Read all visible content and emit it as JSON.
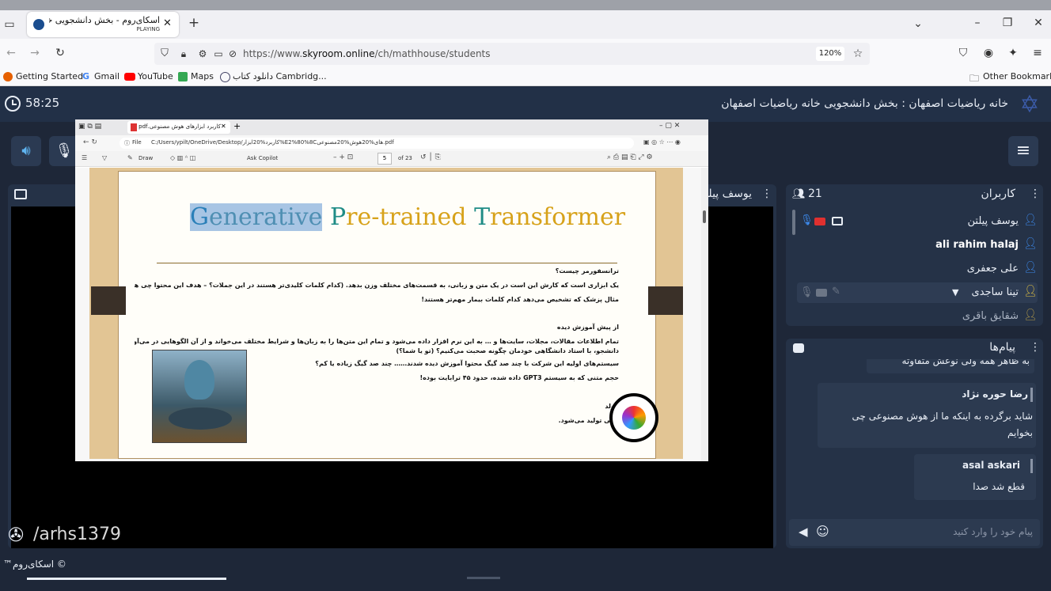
{
  "browser": {
    "tab_title": "اسکای‌روم - بخش دانشجویی خا",
    "tab_status": "PLAYING",
    "url": "https://www.skyroom.online/ch/mathhouse/students",
    "url_prefix": "https://www.",
    "url_domain": "skyroom.online",
    "url_path": "/ch/mathhouse/students",
    "zoom": "120%",
    "bookmarks": [
      "Getting Started",
      "Gmail",
      "YouTube",
      "Maps",
      "دانلود کتاب Cambridg..."
    ],
    "other_bookmarks": "Other Bookmarks"
  },
  "app": {
    "timer": "58:25",
    "room_title": "خانه ریاضیات اصفهان : بخش دانشجویی خانه ریاضیات اصفهان",
    "presenter_name": "یوسف پیلتن",
    "footer_brand": "© اسکای‌روم™",
    "watermark": "/arhs1379"
  },
  "users_panel": {
    "title": "کاربران",
    "count": "21",
    "users": [
      {
        "name": "یوسف پیلتن"
      },
      {
        "name": "ali rahim halaj"
      },
      {
        "name": "علی جعفری"
      },
      {
        "name": "تینا ساجدی"
      },
      {
        "name": "شقایق باقری"
      }
    ]
  },
  "messages_panel": {
    "title": "پیام‌ها",
    "partial_text": "به ظاهر همه ولی نوعش متفاوته",
    "messages": [
      {
        "sender": "رضا حوره نژاد",
        "text": "شاید برگرده به اینکه ما از هوش مصنوعی چی بخوایم"
      },
      {
        "sender": "asal askari",
        "text": "قطع شد صدا"
      }
    ],
    "input_placeholder": "پیام خود را وارد کنید"
  },
  "pdf": {
    "tab_title": "کاربرد ابزارهای هوش مصنوعی.pdf",
    "file_label": "File",
    "path": "C:/Users/ypilt/OneDrive/Desktop/کاربرد%20ابزار%E2%80%8Cهای%20هوش%20مصنوعی.pdf",
    "draw_label": "Draw",
    "ask_copilot": "Ask Copilot",
    "page_num": "5",
    "page_total": "of 23",
    "heading": {
      "g": "G",
      "enerative": "enerative",
      "p": "P",
      "retrained": "re-trained",
      "t": "T",
      "ransformer": "ransformer"
    },
    "lines": [
      "ترانسفورمر چیست؟",
      "یک ابزاری است که کارش این است در یک متن و زبانی، به قسمت‌های مختلف وزن بدهد. (کدام کلمات کلیدی‌تر هستند در این جملات؟ – هدف این محتوا چی هست؟ و…)",
      "مثال پزشک که تشخیص می‌دهد کدام کلمات بیمار مهم‌تر هستند!",
      "از پیش آموزش دیده",
      "تمام اطلاعات مقالات، مجلات، سایت‌ها و … به این نرم افزار داده می‌شود و تمام این متن‌ها را به زبان‌ها و شرایط مختلف می‌خواند و از آن الگوهایی در می‌آورد: مثلا ما به عنوان یک",
      "دانشجو، با استاد دانشگاهی خودمان چگونه صحبت می‌کنیم؟ (تو یا شما؟)",
      "سیستم‌های اولیه این شرکت با چند صد گیگ محتوا آموزش دیده شدند…… چند صد گیگ زیاده یا کم؟",
      "حجم متنی که به سیستم GPT3 داده شده، حدود ۴۵ ترابایت بوده!",
      "مولد",
      "یعنی تولید می‌شود."
    ]
  },
  "colors": {
    "app_bg": "#1e2738",
    "panel_bg": "#253247",
    "accent_red": "#e0302f",
    "accent_blue": "#3d8bef",
    "gen_blue": "#2a7fb8",
    "gen_yellow": "#d7a21a",
    "gen_teal": "#1f8c86"
  }
}
